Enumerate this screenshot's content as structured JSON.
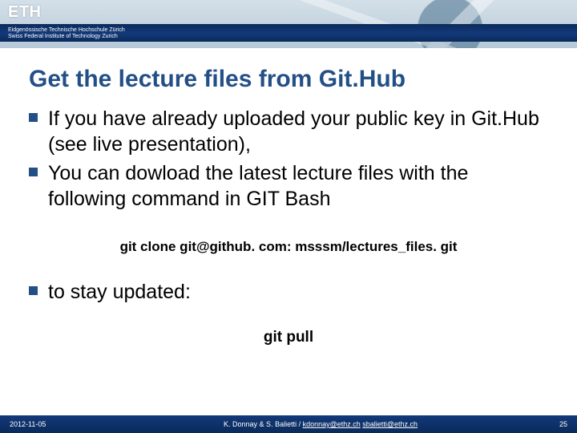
{
  "banner": {
    "logo": "ETH",
    "subtitle_line1": "Eidgenössische Technische Hochschule Zürich",
    "subtitle_line2": "Swiss Federal Institute of Technology Zurich"
  },
  "title": "Get the lecture files from Git.Hub",
  "bullets": {
    "b1": "If you have already uploaded your public key in Git.Hub (see live presentation),",
    "b2": "You can dowload the latest lecture files with the following command in GIT Bash",
    "b3": "to stay updated:"
  },
  "commands": {
    "clone": "git clone git@github. com: msssm/lectures_files. git",
    "pull": "git pull"
  },
  "footer": {
    "date": "2012-11-05",
    "authors": "K. Donnay & S. Balietti / ",
    "email1": "kdonnay@ethz.ch",
    "sep": "   ",
    "email2": "sbalietti@ethz.ch",
    "page": "25"
  }
}
